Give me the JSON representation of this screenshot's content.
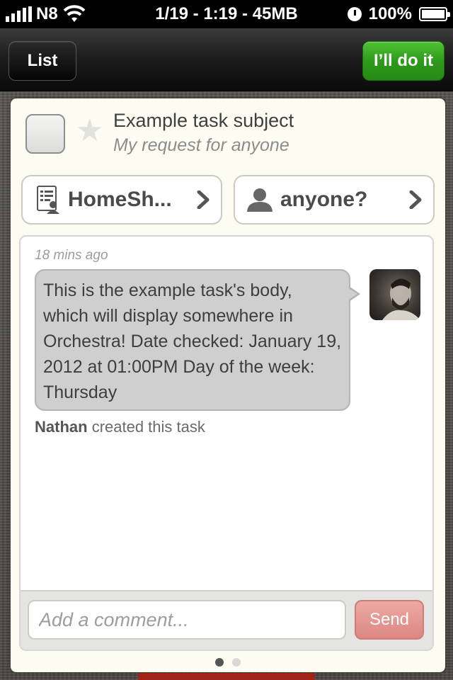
{
  "status_bar": {
    "carrier": "N8",
    "center": "1/19 - 1:19 - 45MB",
    "battery": "100%"
  },
  "nav": {
    "list_label": "List",
    "action_label": "I’ll do it"
  },
  "task": {
    "subject": "Example task subject",
    "subtitle": "My request for anyone",
    "project_label": "HomeSh...",
    "assignee_label": "anyone?"
  },
  "activity": {
    "time": "18 mins ago",
    "body": "This is the example task's body, which will display somewhere in Orchestra! Date checked: January 19, 2012 at 01:00PM Day of the week: Thursday",
    "author": "Nathan",
    "action": "created this task"
  },
  "compose": {
    "placeholder": "Add a comment...",
    "send_label": "Send"
  },
  "pager": {
    "count": 2,
    "active": 0
  },
  "colors": {
    "accent_green": "#3aa827",
    "send_red": "#e29691",
    "card_bg": "#fdfcf3"
  },
  "icons": [
    "wifi-icon",
    "clock-icon",
    "battery-icon",
    "star-icon",
    "list-icon",
    "person-icon",
    "chevron-right-icon"
  ]
}
